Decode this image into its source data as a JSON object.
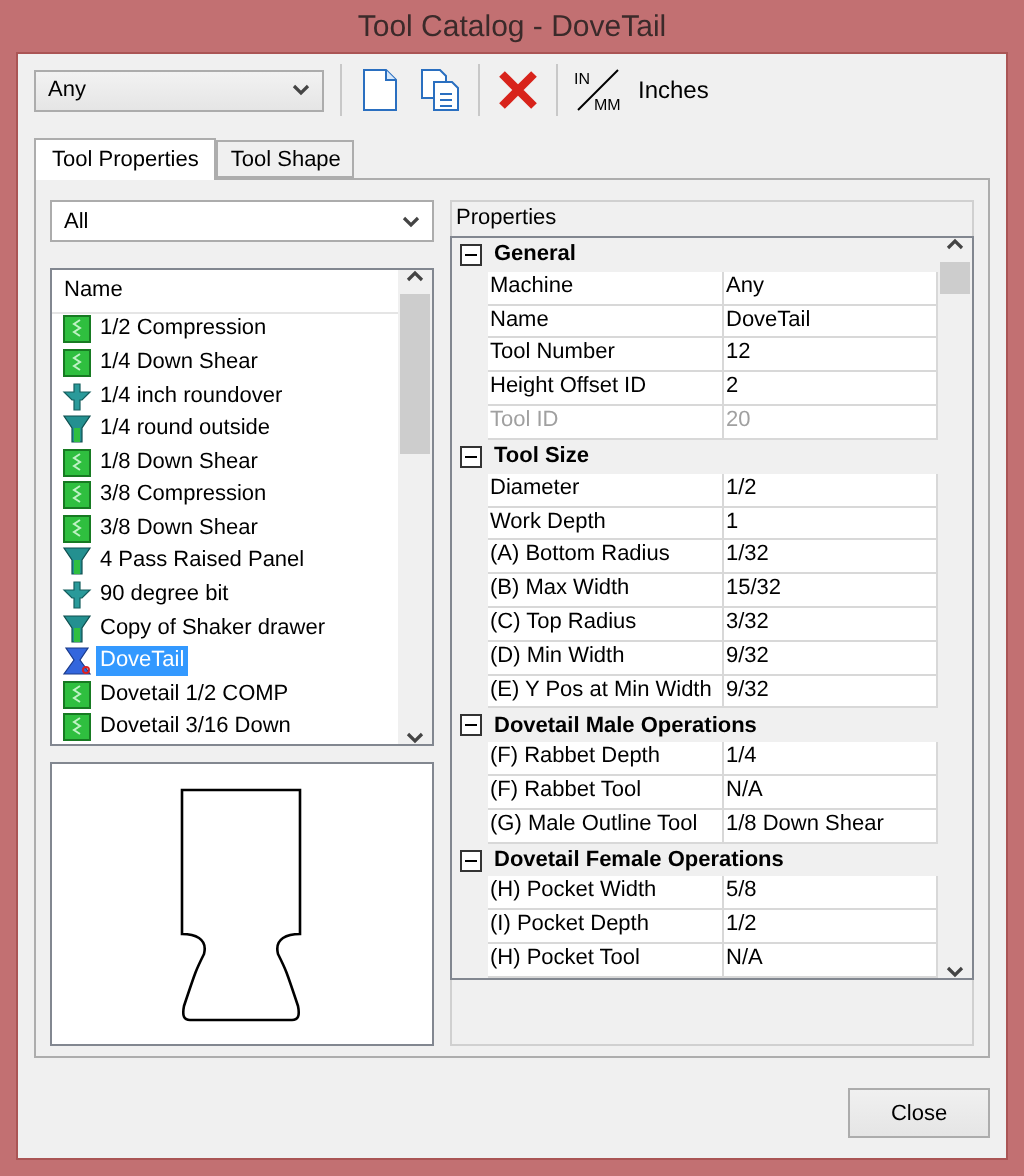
{
  "window": {
    "title": "Tool Catalog - DoveTail"
  },
  "toolbar": {
    "machine": "Any",
    "units_icon": {
      "top": "IN",
      "bottom": "MM"
    },
    "units": "Inches"
  },
  "tabs": [
    {
      "label": "Tool Properties",
      "selected": true
    },
    {
      "label": "Tool Shape",
      "selected": false
    }
  ],
  "filter": "All",
  "tool_list": {
    "header": "Name",
    "items": [
      {
        "name": "1/2 Compression",
        "kind": "flat",
        "selected": false
      },
      {
        "name": "1/4 Down Shear",
        "kind": "flat",
        "selected": false
      },
      {
        "name": "1/4 inch roundover",
        "kind": "roundover",
        "selected": false
      },
      {
        "name": "1/4 round outside",
        "kind": "vbit",
        "selected": false
      },
      {
        "name": "1/8 Down Shear",
        "kind": "flat",
        "selected": false
      },
      {
        "name": "3/8 Compression",
        "kind": "flat",
        "selected": false
      },
      {
        "name": "3/8 Down Shear",
        "kind": "flat",
        "selected": false
      },
      {
        "name": "4 Pass Raised Panel",
        "kind": "vbit",
        "selected": false
      },
      {
        "name": "90 degree bit",
        "kind": "roundover",
        "selected": false
      },
      {
        "name": "Copy of Shaker drawer",
        "kind": "vbit",
        "selected": false
      },
      {
        "name": "DoveTail",
        "kind": "dovetail",
        "selected": true
      },
      {
        "name": "Dovetail 1/2 COMP",
        "kind": "flat",
        "selected": false
      },
      {
        "name": "Dovetail 3/16 Down",
        "kind": "flat",
        "selected": false
      }
    ]
  },
  "properties": {
    "header": "Properties",
    "groups": [
      {
        "title": "General",
        "expanded": true,
        "rows": [
          {
            "label": "Machine",
            "value": "Any",
            "disabled": false
          },
          {
            "label": "Name",
            "value": "DoveTail",
            "disabled": false
          },
          {
            "label": "Tool Number",
            "value": "12",
            "disabled": false
          },
          {
            "label": "Height Offset ID",
            "value": "2",
            "disabled": false
          },
          {
            "label": "Tool ID",
            "value": "20",
            "disabled": true
          }
        ]
      },
      {
        "title": "Tool Size",
        "expanded": true,
        "rows": [
          {
            "label": "Diameter",
            "value": "1/2",
            "disabled": false
          },
          {
            "label": "Work Depth",
            "value": "1",
            "disabled": false
          },
          {
            "label": "(A) Bottom Radius",
            "value": "1/32",
            "disabled": false
          },
          {
            "label": "(B) Max Width",
            "value": "15/32",
            "disabled": false
          },
          {
            "label": "(C) Top Radius",
            "value": "3/32",
            "disabled": false
          },
          {
            "label": "(D) Min Width",
            "value": "9/32",
            "disabled": false
          },
          {
            "label": "(E) Y Pos at Min Width",
            "value": "9/32",
            "disabled": false
          }
        ]
      },
      {
        "title": "Dovetail Male Operations",
        "expanded": true,
        "rows": [
          {
            "label": "(F) Rabbet Depth",
            "value": "1/4",
            "disabled": false
          },
          {
            "label": "(F) Rabbet Tool",
            "value": "N/A",
            "disabled": false
          },
          {
            "label": "(G) Male Outline Tool",
            "value": "1/8 Down Shear",
            "disabled": false
          }
        ]
      },
      {
        "title": "Dovetail Female Operations",
        "expanded": true,
        "rows": [
          {
            "label": "(H) Pocket Width",
            "value": "5/8",
            "disabled": false
          },
          {
            "label": "(I) Pocket Depth",
            "value": "1/2",
            "disabled": false
          },
          {
            "label": "(H) Pocket Tool",
            "value": "N/A",
            "disabled": false
          }
        ]
      }
    ]
  },
  "buttons": {
    "close": "Close"
  }
}
